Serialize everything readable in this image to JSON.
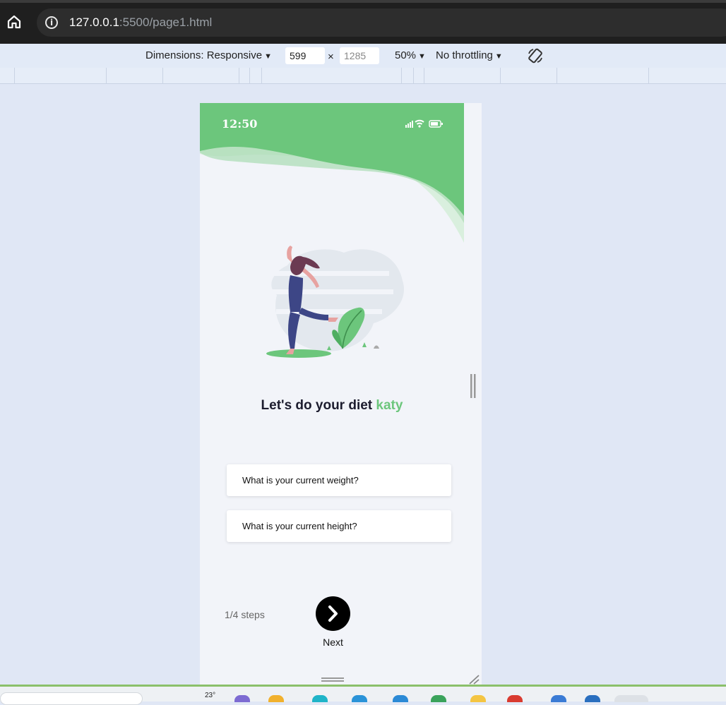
{
  "browser": {
    "url_host": "127.0.0.1",
    "url_rest": ":5500/page1.html"
  },
  "devtools": {
    "dimensions_label": "Dimensions: Responsive",
    "width_value": "599",
    "height_placeholder": "1285",
    "times_sign": "×",
    "zoom": "50%",
    "throttling": "No throttling"
  },
  "device": {
    "status_time": "12:50",
    "title_main": "Let's do your diet ",
    "title_accent": "katy",
    "fields": [
      {
        "label": "What is your current weight?"
      },
      {
        "label": "What is your current height?"
      }
    ],
    "steps": "1/4 steps",
    "next_label": "Next"
  },
  "taskbar": {
    "temperature": "23°"
  },
  "colors": {
    "accent_green": "#6cc67c",
    "title_dark": "#1c1c2e",
    "device_bg": "#f2f4f9",
    "browser_dark": "#1f1f1f"
  },
  "icons": [
    "home-icon",
    "info-icon",
    "rotate-icon",
    "signal-icon",
    "wifi-icon",
    "battery-icon",
    "chevron-right-icon"
  ]
}
